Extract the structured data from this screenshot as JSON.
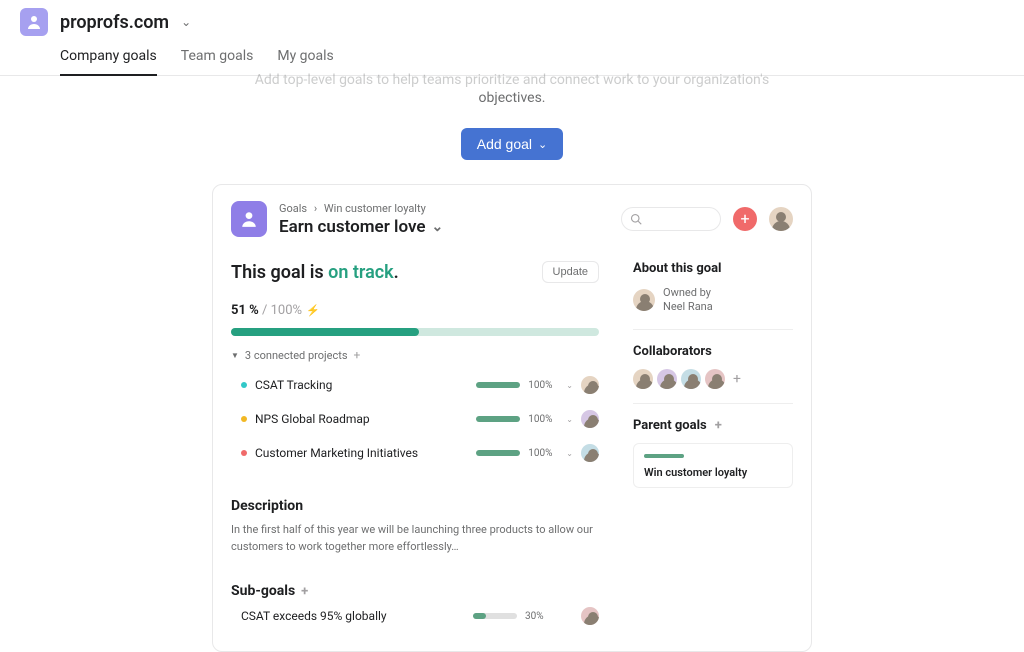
{
  "org": {
    "name": "proprofs.com"
  },
  "tabs": {
    "company": "Company goals",
    "team": "Team goals",
    "my": "My goals"
  },
  "hero": {
    "line1": "Add top-level goals to help teams prioritize and connect work to your organization's",
    "line2": "objectives."
  },
  "addGoalLabel": "Add goal",
  "breadcrumbs": {
    "root": "Goals",
    "parent": "Win customer loyalty"
  },
  "goal": {
    "title": "Earn customer love"
  },
  "status": {
    "prefix": "This goal is ",
    "state": "on track",
    "suffix": "."
  },
  "updateLabel": "Update",
  "progress": {
    "pct": "51 %",
    "sep": " / ",
    "total": "100%",
    "fillPercent": 51
  },
  "connectedProjects": {
    "label": "3 connected projects"
  },
  "projects": [
    {
      "name": "CSAT Tracking",
      "pct": "100%",
      "dot": "d-teal"
    },
    {
      "name": "NPS Global Roadmap",
      "pct": "100%",
      "dot": "d-amber"
    },
    {
      "name": "Customer Marketing Initiatives",
      "pct": "100%",
      "dot": "d-coral"
    }
  ],
  "description": {
    "heading": "Description",
    "body": "In the first half of this year we will be launching three products to allow our customers to work together more effortlessly…"
  },
  "subgoals": {
    "heading": "Sub-goals",
    "items": [
      {
        "name": "CSAT exceeds 95% globally",
        "pct": "30%"
      }
    ]
  },
  "about": {
    "heading": "About this goal",
    "ownedByLabel": "Owned by",
    "ownerName": "Neel Rana"
  },
  "collaborators": {
    "heading": "Collaborators"
  },
  "parentGoals": {
    "heading": "Parent goals",
    "item": "Win customer loyalty"
  }
}
